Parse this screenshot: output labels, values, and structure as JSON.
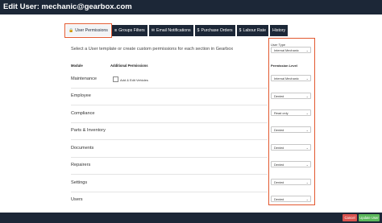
{
  "header": {
    "title": "Edit User: mechanic@gearbox.com"
  },
  "tabs": [
    {
      "label": "User Permissions",
      "icon": "lock-icon"
    },
    {
      "label": "Groups Filters",
      "icon": "filter-icon"
    },
    {
      "label": "Email Notifications",
      "icon": "envelope-icon"
    },
    {
      "label": "Purchase Orders",
      "icon": "dollar-icon"
    },
    {
      "label": "Labour Rate",
      "icon": "dollar-icon"
    },
    {
      "label": "History",
      "icon": ""
    }
  ],
  "intro_text": "Select a User template or create custom permissions for each section in Gearbox",
  "columns": {
    "module": "Module",
    "additional_permissions": "Additional Permissions",
    "user_type": "User Type",
    "permission_level": "Permission Level"
  },
  "user_type_value": "Internal Mechanic",
  "modules": [
    {
      "name": "Maintenance",
      "level": "Internal Mechanic"
    },
    {
      "name": "Employee",
      "level": "Denied"
    },
    {
      "name": "Compliance",
      "level": "Read only"
    },
    {
      "name": "Parts & Inventory",
      "level": "Denied"
    },
    {
      "name": "Documents",
      "level": "Denied"
    },
    {
      "name": "Repairers",
      "level": "Denied"
    },
    {
      "name": "Settings",
      "level": "Denied"
    },
    {
      "name": "Users",
      "level": "Denied"
    }
  ],
  "additional_permission": {
    "label": "Add & Edit Vehicles",
    "checked": false
  },
  "buttons": {
    "cancel": "Cancel",
    "update": "Update User"
  },
  "colors": {
    "navy": "#1c2737",
    "highlight": "#e2582f",
    "cancel": "#d9534f",
    "update": "#5cb85c"
  }
}
